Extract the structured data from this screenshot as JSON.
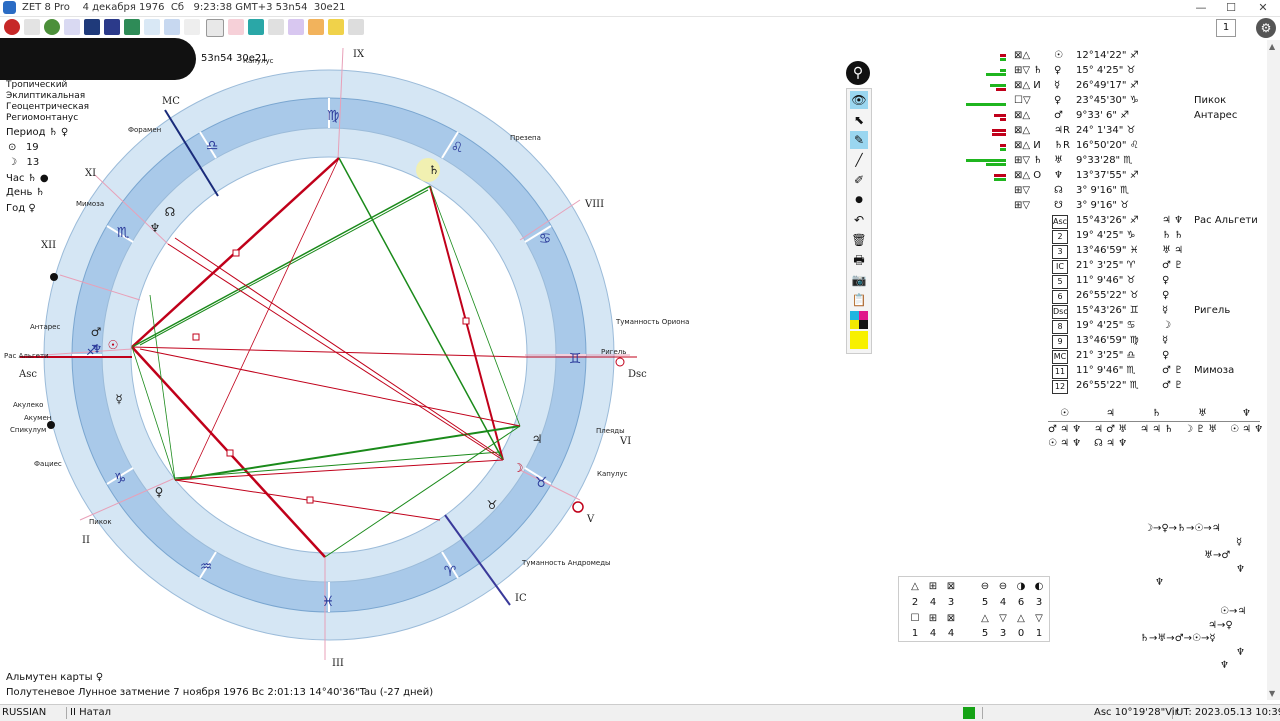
{
  "titlebar": {
    "title": "ZET 8 Pro    4 декабря 1976  Сб   9:23:38 GMT+3 53n54  30e21",
    "min": "—",
    "max": "☐",
    "close": "✕"
  },
  "toolbar": {
    "page": "1",
    "settings_icon": "⚙"
  },
  "header": {
    "coords": "53n54  30e21"
  },
  "chart_params": {
    "lines": [
      "Тропический",
      "Эклиптикальная",
      "Геоцентрическая",
      "Региомонтанус"
    ],
    "period_label": "Период",
    "period_val": "♄ ♀",
    "sun_num": "19",
    "moon_num": "13",
    "hour_label": "Час",
    "hour_val": "♄",
    "day_label": "День",
    "day_val": "♄",
    "year_label": "Год",
    "year_val": "♀"
  },
  "wheel": {
    "houses": {
      "IX": "IX",
      "XI": "XI",
      "XII": "XII",
      "Asc": "Asc",
      "II": "II",
      "III": "III",
      "IC": "IC",
      "V": "V",
      "VI": "VI",
      "Dsc": "Dsc",
      "VIII": "VIII",
      "MC": "MC"
    },
    "stars": [
      "Капулус",
      "Форамен",
      "Мимоза",
      "Антарес",
      "Рас Альгети",
      "Акулеко",
      "Акумен",
      "Спикулум",
      "Фациес",
      "Пикок",
      "Презепа",
      "Туманность Ориона",
      "Ригель",
      "Плеяды",
      "Капулус",
      "Туманность Андромеды"
    ],
    "signs": [
      "♍",
      "♎",
      "♏",
      "♐",
      "♑",
      "♒",
      "♓",
      "♈",
      "♉",
      "♊",
      "♋",
      "♌"
    ],
    "planets": [
      "♄",
      "♅",
      "♆",
      "☉",
      "♂",
      "☿",
      "♀",
      "♃",
      "☽",
      "♇",
      "☊",
      "☋"
    ]
  },
  "footer": {
    "almuten": "Альмутен карты  ♀",
    "eclipse": "Полутеневое Лунное затмение 7 ноября 1976 Вс  2:01:13 14°40'36\"Tau (-27 дней)"
  },
  "palette": {
    "pin": "⚲",
    "tools": [
      "👁",
      "⬉",
      "✎",
      "╱",
      "✐",
      "●",
      "↶",
      "🗑",
      "🖶",
      "📷",
      "📋"
    ]
  },
  "planet_table": [
    {
      "aspects": "⊠△",
      "pl": "☉",
      "pos": "12°14'22\" ♐",
      "star": ""
    },
    {
      "aspects": "⊞▽ ♄",
      "pl": "♀",
      "pos": "15° 4'25\" ♉",
      "star": ""
    },
    {
      "aspects": "⊠△ И",
      "pl": "☿",
      "pos": "26°49'17\" ♐",
      "star": ""
    },
    {
      "aspects": "☐▽",
      "pl": "♀",
      "pos": "23°45'30\" ♑",
      "star": "Пикок"
    },
    {
      "aspects": "⊠△",
      "pl": "♂",
      "pos": " 9°33' 6\" ♐",
      "star": "Антарес"
    },
    {
      "aspects": "⊠△",
      "pl": "♃R",
      "pos": "24° 1'34\" ♉",
      "star": ""
    },
    {
      "aspects": "⊠△ И",
      "pl": "♄R",
      "pos": "16°50'20\" ♌",
      "star": ""
    },
    {
      "aspects": "⊞▽ ♄",
      "pl": "♅",
      "pos": " 9°33'28\" ♏",
      "star": ""
    },
    {
      "aspects": "⊠△ О",
      "pl": "♆",
      "pos": "13°37'55\" ♐",
      "star": ""
    },
    {
      "aspects": "⊞▽",
      "pl": "☊",
      "pos": " 3° 9'16\" ♏",
      "star": ""
    },
    {
      "aspects": "⊞▽",
      "pl": "☋",
      "pos": " 3° 9'16\" ♉",
      "star": ""
    }
  ],
  "house_table": [
    {
      "n": "Asc",
      "pos": "15°43'26\" ♐",
      "r": "♃ ♆",
      "s": "Рас Альгети"
    },
    {
      "n": "2",
      "pos": "19° 4'25\" ♑",
      "r": "♄ ♄",
      "s": ""
    },
    {
      "n": "3",
      "pos": "13°46'59\" ♓",
      "r": "♅ ♃",
      "s": ""
    },
    {
      "n": "IC",
      "pos": "21° 3'25\" ♈",
      "r": "♂ ♇",
      "s": ""
    },
    {
      "n": "5",
      "pos": "11° 9'46\" ♉",
      "r": "♀",
      "s": ""
    },
    {
      "n": "6",
      "pos": "26°55'22\" ♉",
      "r": "♀",
      "s": ""
    },
    {
      "n": "Dsc",
      "pos": "15°43'26\" ♊",
      "r": "☿",
      "s": "Ригель"
    },
    {
      "n": "8",
      "pos": "19° 4'25\" ♋",
      "r": "☽",
      "s": ""
    },
    {
      "n": "9",
      "pos": "13°46'59\" ♍",
      "r": "☿",
      "s": ""
    },
    {
      "n": "MC",
      "pos": "21° 3'25\" ♎",
      "r": "♀",
      "s": ""
    },
    {
      "n": "11",
      "pos": "11° 9'46\" ♏",
      "r": "♂ ♇",
      "s": "Мимоза"
    },
    {
      "n": "12",
      "pos": "26°55'22\" ♏",
      "r": "♂ ♇",
      "s": ""
    }
  ],
  "rulers": {
    "heads": [
      "☉",
      "♃",
      "♄",
      "♅",
      "♆"
    ],
    "row1": [
      "♂ ♃ ♆",
      "♃ ♂ ♅",
      "♃ ♃ ♄",
      "☽ ♇ ♅",
      "☉ ♃ ♆"
    ],
    "row2": [
      "☉ ♃ ♆",
      "☊ ♃ ♆",
      "",
      "",
      ""
    ]
  },
  "aspect_counts": {
    "top": [
      "2",
      "4",
      "3",
      "5",
      "4",
      "6",
      "3"
    ],
    "bottom": [
      "1",
      "4",
      "4",
      "5",
      "3",
      "0",
      "1"
    ]
  },
  "chains": {
    "c1": "☽→♀→♄→☉→♃",
    "c2": "☿",
    "c3": "♅→♂",
    "c4": "♆",
    "c5": "♆",
    "c6": "☉→♃",
    "c7": "♃→♀",
    "c8": "♄→♅→♂→☉→☿",
    "c9": "♆",
    "c10": "♆"
  },
  "statusbar": {
    "lang": "RUSSIAN",
    "mode": "II Натал",
    "asc": "Asc  10°19'28\"Vir",
    "ut": "UT: 2023.05.13 10:39:30"
  }
}
